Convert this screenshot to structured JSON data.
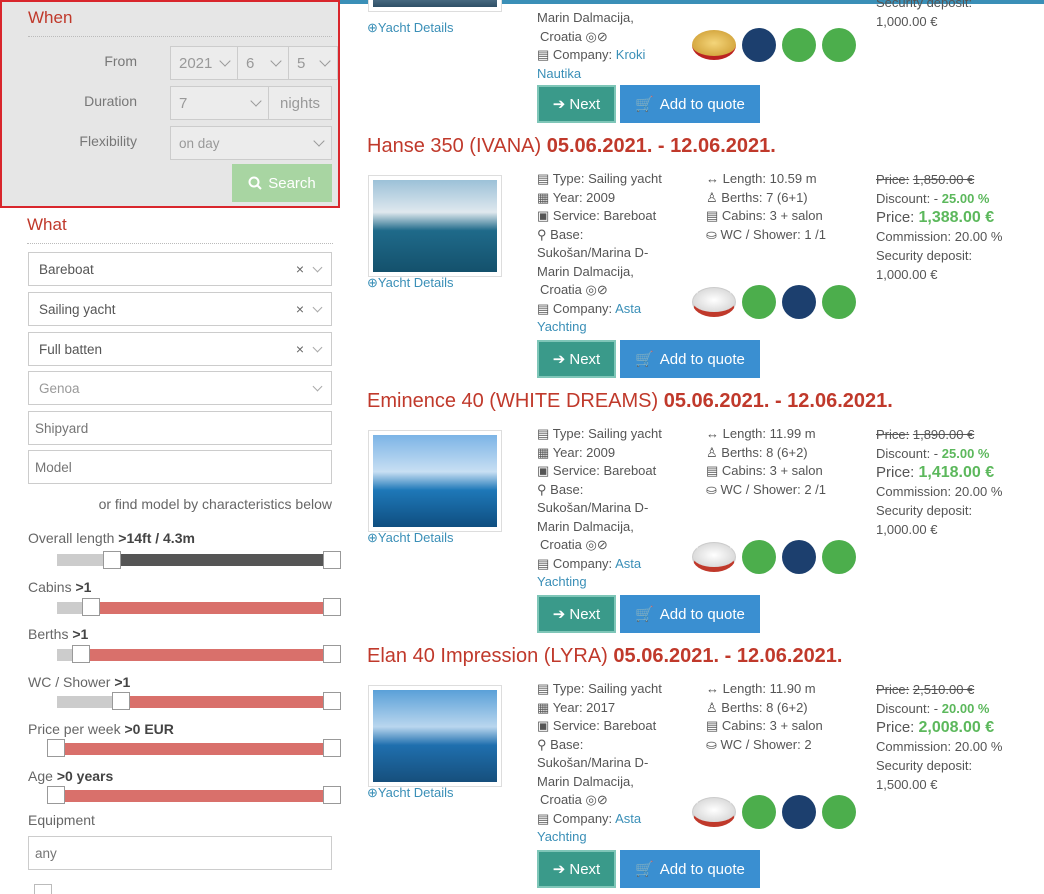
{
  "sidebar": {
    "when_title": "When",
    "from_label": "From",
    "from_year": "2021",
    "from_month": "6",
    "from_day": "5",
    "duration_label": "Duration",
    "duration_value": "7",
    "duration_unit": "nights",
    "flex_label": "Flexibility",
    "flex_value": "on day",
    "search_label": "Search",
    "what_title": "What",
    "filters": [
      "Bareboat",
      "Sailing yacht",
      "Full batten"
    ],
    "genoa": "Genoa",
    "shipyard_placeholder": "Shipyard",
    "model_placeholder": "Model",
    "find_model_text": "or find model by characteristics below",
    "ranges": [
      {
        "label": "Overall length",
        "value": ">14ft / 4.3m"
      },
      {
        "label": "Cabins",
        "value": ">1"
      },
      {
        "label": "Berths",
        "value": ">1"
      },
      {
        "label": "WC / Shower",
        "value": ">1"
      },
      {
        "label": "Price per week",
        "value": ">0 EUR"
      },
      {
        "label": "Age",
        "value": ">0 years"
      }
    ],
    "equipment_label": "Equipment",
    "equipment_placeholder": "any"
  },
  "top_partial": {
    "yacht_details": "Yacht Details",
    "base_line1": "Marin Dalmacija,",
    "base_line2": "Croatia",
    "company_label": "Company:",
    "company_name1": "Kroki",
    "company_name2": "Nautika",
    "security_label": "Security deposit:",
    "security_value": "1,000.00 €"
  },
  "buttons": {
    "next": "Next",
    "quote": "Add to quote",
    "yacht_details": "Yacht Details"
  },
  "yachts": [
    {
      "name": "Hanse 350 (IVANA)",
      "dates": "05.06.2021. - 12.06.2021.",
      "type": "Type: Sailing yacht",
      "year": "Year: 2009",
      "service": "Service: Bareboat",
      "base": "Base:",
      "base_loc1": "Sukošan/Marina D-",
      "base_loc2": "Marin Dalmacija,",
      "base_loc3": "Croatia",
      "company": "Company:",
      "company_name1": "Asta",
      "company_name2": "Yachting",
      "length": "Length: 10.59 m",
      "berths": "Berths: 7 (6+1)",
      "cabins": "Cabins: 3 + salon",
      "wc": "WC / Shower: 1 /1",
      "price_old_label": "Price:",
      "price_old": "1,850.00 €",
      "discount_label": "Discount: -",
      "discount": "25.00 %",
      "price_label": "Price:",
      "price": "1,388.00 €",
      "commission": "Commission: 20.00 %",
      "security_label": "Security deposit:",
      "security": "1,000.00 €"
    },
    {
      "name": "Eminence 40 (WHITE DREAMS)",
      "dates": "05.06.2021. - 12.06.2021.",
      "type": "Type: Sailing yacht",
      "year": "Year: 2009",
      "service": "Service: Bareboat",
      "base": "Base:",
      "base_loc1": "Sukošan/Marina D-",
      "base_loc2": "Marin Dalmacija,",
      "base_loc3": "Croatia",
      "company": "Company:",
      "company_name1": "Asta",
      "company_name2": "Yachting",
      "length": "Length: 11.99 m",
      "berths": "Berths: 8 (6+2)",
      "cabins": "Cabins: 3 + salon",
      "wc": "WC / Shower: 2 /1",
      "price_old_label": "Price:",
      "price_old": "1,890.00 €",
      "discount_label": "Discount: -",
      "discount": "25.00 %",
      "price_label": "Price:",
      "price": "1,418.00 €",
      "commission": "Commission: 20.00 %",
      "security_label": "Security deposit:",
      "security": "1,000.00 €"
    },
    {
      "name": "Elan 40 Impression (LYRA)",
      "dates": "05.06.2021. - 12.06.2021.",
      "type": "Type: Sailing yacht",
      "year": "Year: 2017",
      "service": "Service: Bareboat",
      "base": "Base:",
      "base_loc1": "Sukošan/Marina D-",
      "base_loc2": "Marin Dalmacija,",
      "base_loc3": "Croatia",
      "company": "Company:",
      "company_name1": "Asta",
      "company_name2": "Yachting",
      "length": "Length: 11.90 m",
      "berths": "Berths: 8 (6+2)",
      "cabins": "Cabins: 3 + salon",
      "wc": "WC / Shower: 2",
      "price_old_label": "Price:",
      "price_old": "2,510.00 €",
      "discount_label": "Discount: -",
      "discount": "20.00 %",
      "price_label": "Price:",
      "price": "2,008.00 €",
      "commission": "Commission: 20.00 %",
      "security_label": "Security deposit:",
      "security": "1,500.00 €"
    }
  ],
  "colors": {
    "accent": "#c0392b",
    "link": "#3a8fb7",
    "next": "#3a9a8a",
    "quote": "#3a8fd1",
    "green": "#5cb85c"
  }
}
